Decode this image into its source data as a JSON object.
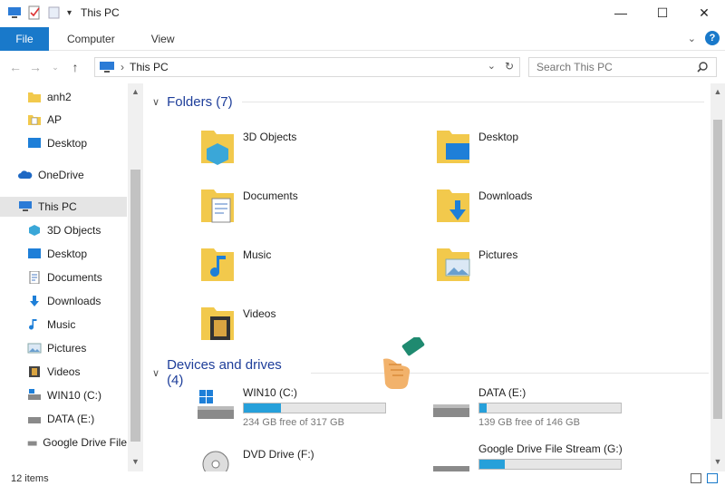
{
  "window": {
    "title": "This PC"
  },
  "ribbon": {
    "file": "File",
    "tabs": [
      "Computer",
      "View"
    ]
  },
  "address": {
    "path": "This PC"
  },
  "search": {
    "placeholder": "Search This PC"
  },
  "sidebar": {
    "items": [
      {
        "label": "anh2",
        "icon": "folder-icon"
      },
      {
        "label": "AP",
        "icon": "document-folder-icon"
      },
      {
        "label": "Desktop",
        "icon": "desktop-icon"
      },
      {
        "label": "OneDrive",
        "icon": "onedrive-icon"
      },
      {
        "label": "This PC",
        "icon": "this-pc-icon"
      },
      {
        "label": "3D Objects",
        "icon": "3d-objects-icon"
      },
      {
        "label": "Desktop",
        "icon": "desktop-icon"
      },
      {
        "label": "Documents",
        "icon": "documents-icon"
      },
      {
        "label": "Downloads",
        "icon": "downloads-icon"
      },
      {
        "label": "Music",
        "icon": "music-icon"
      },
      {
        "label": "Pictures",
        "icon": "pictures-icon"
      },
      {
        "label": "Videos",
        "icon": "videos-icon"
      },
      {
        "label": "WIN10 (C:)",
        "icon": "drive-c-icon"
      },
      {
        "label": "DATA (E:)",
        "icon": "drive-icon"
      },
      {
        "label": "Google Drive File",
        "icon": "drive-icon"
      }
    ]
  },
  "folders": {
    "header": "Folders (7)",
    "items": [
      "3D Objects",
      "Desktop",
      "Documents",
      "Downloads",
      "Music",
      "Pictures",
      "Videos"
    ]
  },
  "devices": {
    "header": "Devices and drives (4)",
    "items": [
      {
        "name": "WIN10 (C:)",
        "free": "234 GB free of 317 GB",
        "used_fraction": 0.26
      },
      {
        "name": "DATA (E:)",
        "free": "139 GB free of 146 GB",
        "used_fraction": 0.05
      },
      {
        "name": "DVD Drive (F:)"
      },
      {
        "name": "Google Drive File Stream (G:)",
        "used_fraction": 0.18
      }
    ]
  },
  "status": {
    "items": "12 items"
  },
  "colors": {
    "accent": "#1979ca",
    "section": "#1e3e9a",
    "bar_fill": "#26a0da",
    "folder": "#f2c94c"
  }
}
